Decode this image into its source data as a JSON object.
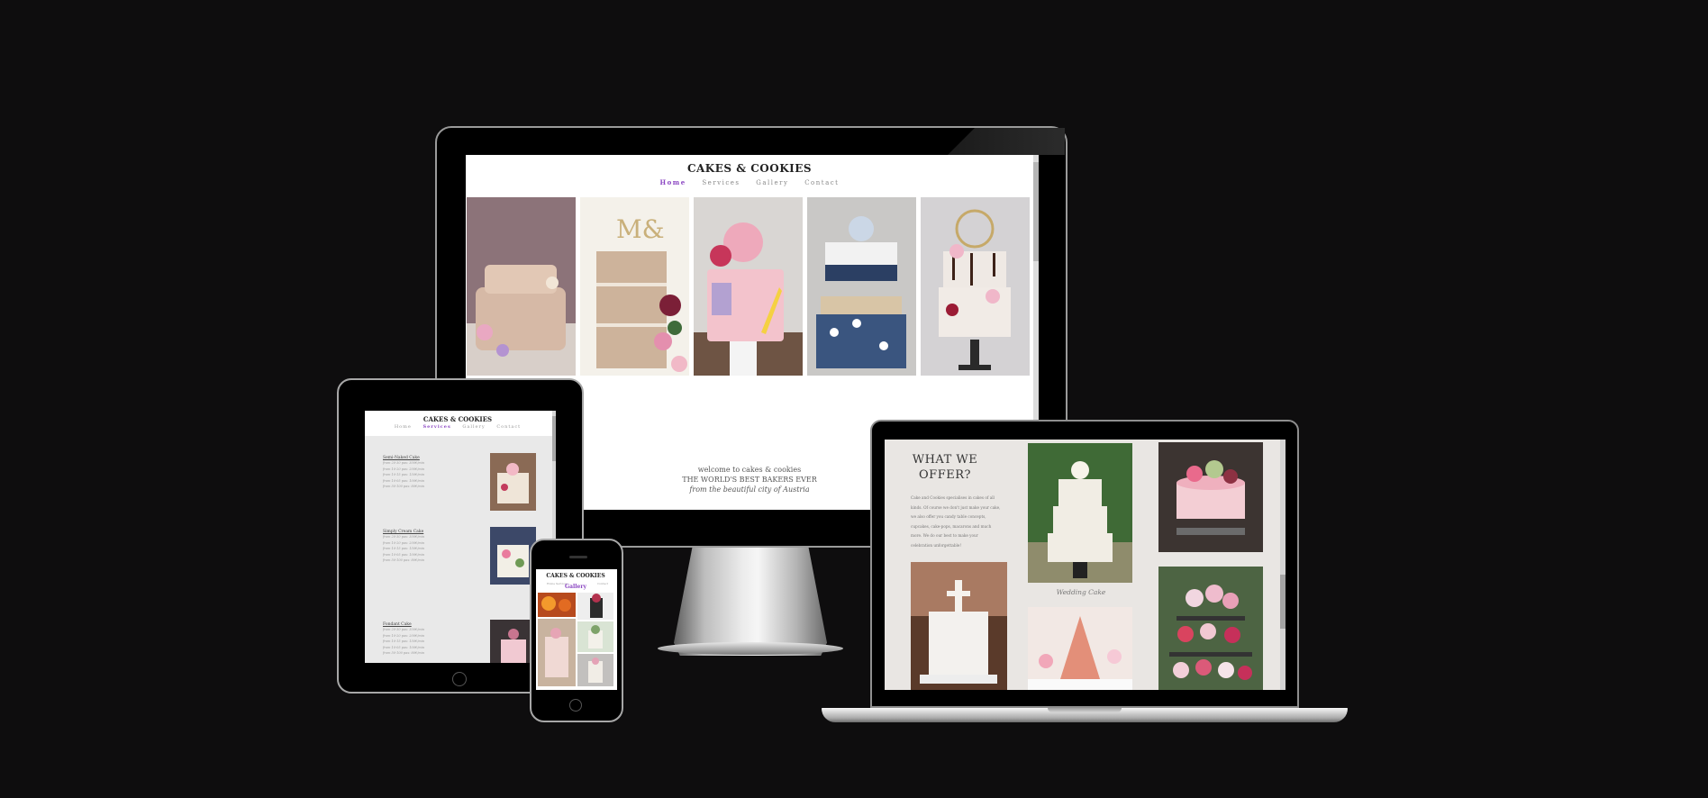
{
  "desktop": {
    "title": "CAKES & COOKIES",
    "nav": [
      "Home",
      "Services",
      "Gallery",
      "Contact"
    ],
    "nav_active": "Home",
    "welcome_line1": "welcome to cakes & cookies",
    "welcome_line2": "THE WORLD'S BEST BAKERS EVER",
    "welcome_line3": "from the beautiful city of Austria"
  },
  "tablet": {
    "title": "CAKES & COOKIES",
    "nav": [
      "Home",
      "Services",
      "Gallery",
      "Contact"
    ],
    "nav_active": "Services",
    "services": [
      {
        "name": "Semi-Naked Cake",
        "prices": [
          "from 20-30 pax: 300€/min",
          "from 10-20 pax: 200€/min",
          "from 10-15 pax: 150€/min",
          "from 10-05 pax: 100€/min",
          "from 50-100 pax: 80€/min"
        ]
      },
      {
        "name": "Simply Cream Cake",
        "prices": [
          "from 20-30 pax: 300€/min",
          "from 10-20 pax: 200€/min",
          "from 10-15 pax: 150€/min",
          "from 10-05 pax: 100€/min",
          "from 50-100 pax: 80€/min"
        ]
      },
      {
        "name": "Fondant Cake",
        "prices": [
          "from 20-30 pax: 300€/min",
          "from 10-20 pax: 200€/min",
          "from 10-15 pax: 150€/min",
          "from 10-05 pax: 100€/min",
          "from 50-100 pax: 80€/min"
        ]
      }
    ]
  },
  "phone": {
    "title": "CAKES & COOKIES",
    "nav_left": "Home Services",
    "nav_active": "Gallery",
    "nav_right": "Contact"
  },
  "laptop": {
    "heading_line1": "WHAT WE",
    "heading_line2": "OFFER?",
    "description": "Cake and Cookies specialises in cakes of all kinds. Of course we don't just make your cake, we also offer you candy table concepts, cupcakes, cake-pops, macarons and much more. We do our best to make your celebration unforgettable!",
    "caption": "Wedding Cake"
  },
  "colors": {
    "background": "#0e0d0e",
    "accent": "#8a45c2",
    "offer_panel": "#e9e6e3"
  }
}
